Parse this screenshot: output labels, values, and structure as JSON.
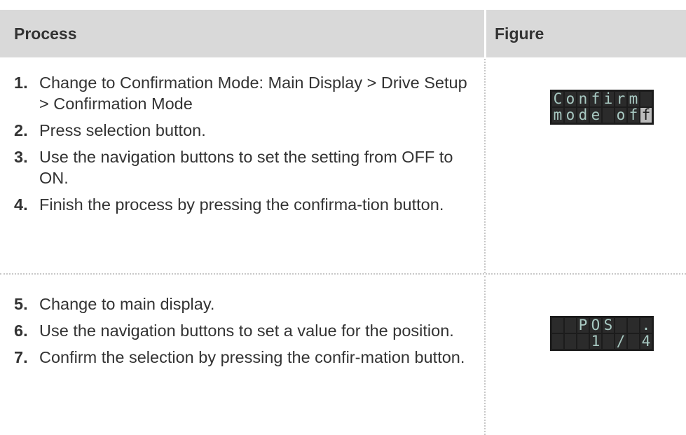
{
  "header": {
    "process": "Process",
    "figure": "Figure"
  },
  "groups": [
    {
      "steps": [
        {
          "num": "1.",
          "text": "Change to Confirmation Mode: Main Display > Drive Setup > Confirmation Mode"
        },
        {
          "num": "2.",
          "text": "Press selection button."
        },
        {
          "num": "3.",
          "text": "Use the navigation buttons to set the setting from OFF to ON."
        },
        {
          "num": "4.",
          "text": "Finish the process by pressing the confirma-tion button."
        }
      ],
      "lcd": {
        "line1": "Confirm ",
        "line2": "mode off",
        "highlight_last_char": true
      }
    },
    {
      "steps": [
        {
          "num": "5.",
          "text": "Change to main display."
        },
        {
          "num": "6.",
          "text": "Use the navigation buttons to set a value for the position."
        },
        {
          "num": "7.",
          "text": "Confirm the selection by pressing the confir-mation button."
        }
      ],
      "lcd": {
        "line1": "  POS  .",
        "line2": "   1 / 4",
        "highlight_last_char": false
      }
    }
  ],
  "colors": {
    "header_bg": "#d9d9d9",
    "text": "#333333",
    "lcd_bg": "#1c1c1c",
    "lcd_text": "#a8c9c2"
  }
}
